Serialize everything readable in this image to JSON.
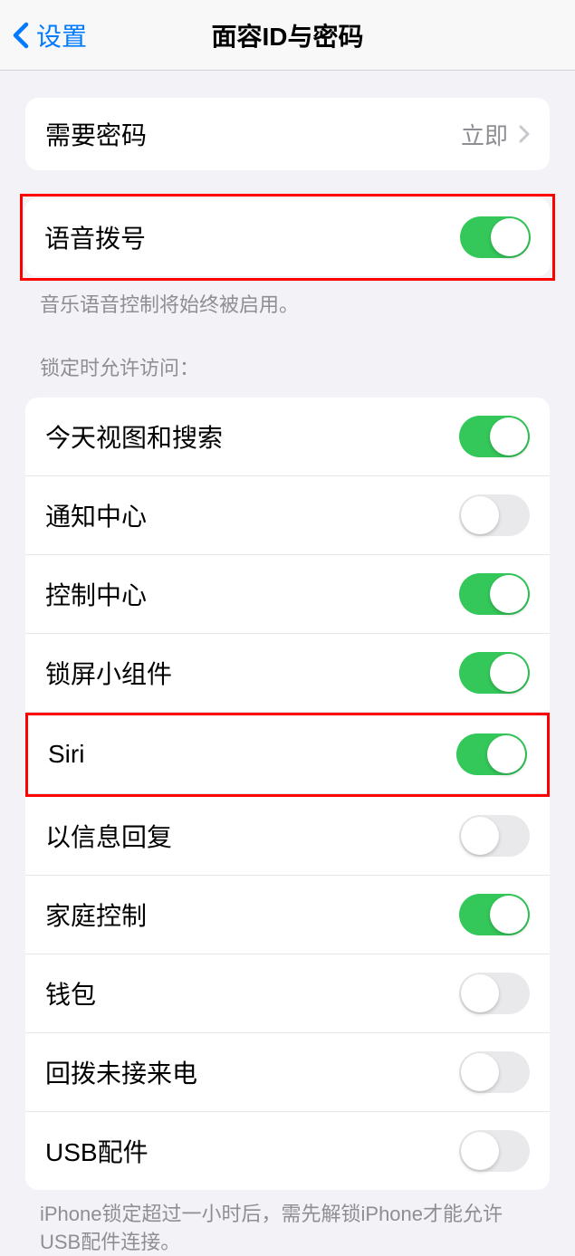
{
  "header": {
    "back_label": "设置",
    "title": "面容ID与密码"
  },
  "passcode": {
    "label": "需要密码",
    "value": "立即"
  },
  "voice_dial": {
    "label": "语音拨号",
    "enabled": true,
    "footer": "音乐语音控制将始终被启用。"
  },
  "lock_section": {
    "header": "锁定时允许访问：",
    "items": [
      {
        "label": "今天视图和搜索",
        "enabled": true
      },
      {
        "label": "通知中心",
        "enabled": false
      },
      {
        "label": "控制中心",
        "enabled": true
      },
      {
        "label": "锁屏小组件",
        "enabled": true
      },
      {
        "label": "Siri",
        "enabled": true
      },
      {
        "label": "以信息回复",
        "enabled": false
      },
      {
        "label": "家庭控制",
        "enabled": true
      },
      {
        "label": "钱包",
        "enabled": false
      },
      {
        "label": "回拨未接来电",
        "enabled": false
      },
      {
        "label": "USB配件",
        "enabled": false
      }
    ],
    "footer": "iPhone锁定超过一小时后，需先解锁iPhone才能允许USB配件连接。"
  }
}
